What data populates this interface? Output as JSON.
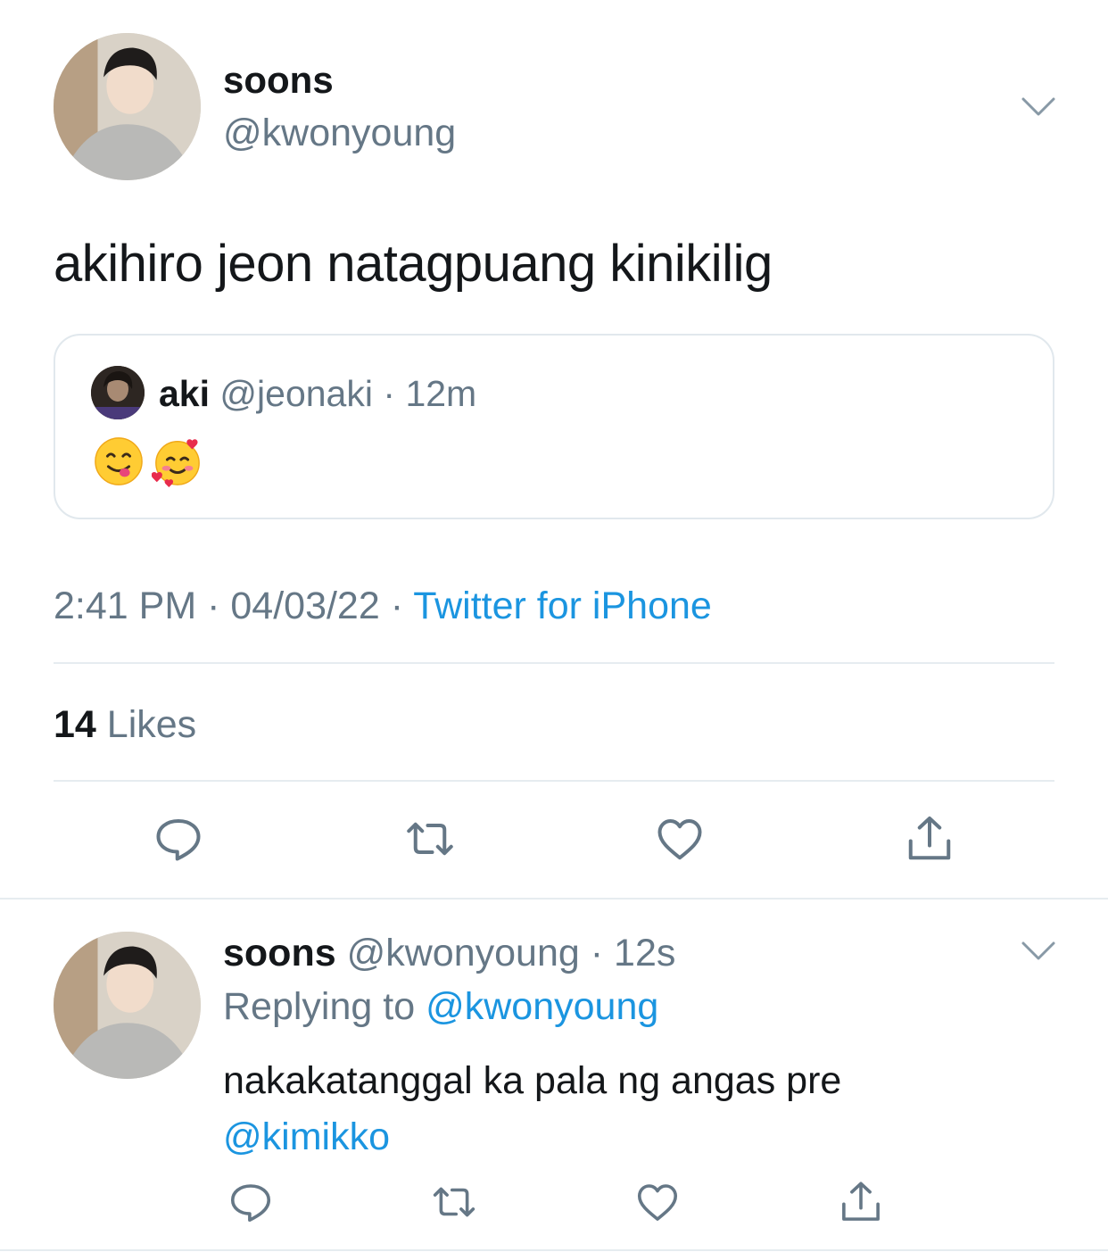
{
  "tweet": {
    "author": {
      "name": "soons",
      "handle": "@kwonyoung"
    },
    "text": "akihiro jeon natagpuang kinikilig",
    "quoted": {
      "name": "aki",
      "handle": "@jeonaki",
      "separator": "·",
      "time": "12m",
      "emojis": [
        "yum-face-emoji",
        "smiling-face-with-hearts-emoji"
      ]
    },
    "time": "2:41 PM",
    "date": "04/03/22",
    "separator": "·",
    "source": "Twitter for iPhone",
    "likes_count": "14",
    "likes_label": "Likes",
    "actions": [
      "reply-icon",
      "retweet-icon",
      "like-icon",
      "share-icon"
    ]
  },
  "reply": {
    "name": "soons",
    "handle": "@kwonyoung",
    "separator": "·",
    "time": "12s",
    "replying_label": "Replying to",
    "replying_to": "@kwonyoung",
    "text": "nakakatanggal ka pala ng angas pre",
    "mention": "@kimikko",
    "actions": [
      "reply-icon",
      "retweet-icon",
      "like-icon",
      "share-icon"
    ]
  },
  "colors": {
    "text": "#14171a",
    "secondary": "#657786",
    "link": "#1b95e0",
    "border": "#e1e8ed",
    "icon": "#657786"
  }
}
